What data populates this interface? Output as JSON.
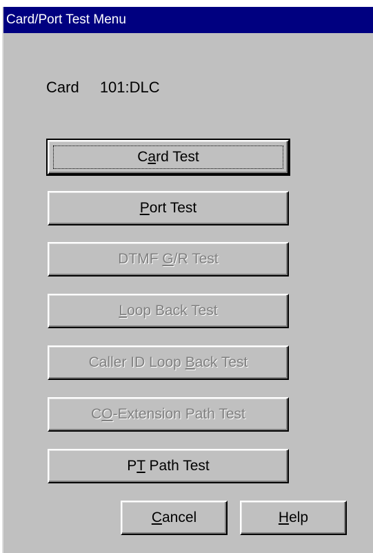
{
  "window": {
    "title": "Card/Port Test Menu"
  },
  "card": {
    "label": "Card",
    "value": "101:DLC"
  },
  "buttons": {
    "card_test": {
      "pre": "C",
      "mnemonic": "a",
      "post": "rd Test",
      "enabled": true
    },
    "port_test": {
      "pre": "",
      "mnemonic": "P",
      "post": "ort Test",
      "enabled": true
    },
    "dtmf_test": {
      "pre": "DTMF ",
      "mnemonic": "G",
      "post": "/R Test",
      "enabled": false
    },
    "loop_back_test": {
      "pre": "",
      "mnemonic": "L",
      "post": "oop Back Test",
      "enabled": false
    },
    "caller_id_test": {
      "pre": "Caller ID Loop ",
      "mnemonic": "B",
      "post": "ack Test",
      "enabled": false
    },
    "co_extension_test": {
      "pre": "C",
      "mnemonic": "O",
      "post": "-Extension Path Test",
      "enabled": false
    },
    "pt_path_test": {
      "pre": "P",
      "mnemonic": "T",
      "post": " Path Test",
      "enabled": true
    },
    "cancel": {
      "pre": "",
      "mnemonic": "C",
      "post": "ancel",
      "enabled": true
    },
    "help": {
      "pre": "",
      "mnemonic": "H",
      "post": "elp",
      "enabled": true
    }
  },
  "colors": {
    "titlebar": "#000080",
    "face": "#c0c0c0",
    "disabled_text": "#808080"
  }
}
